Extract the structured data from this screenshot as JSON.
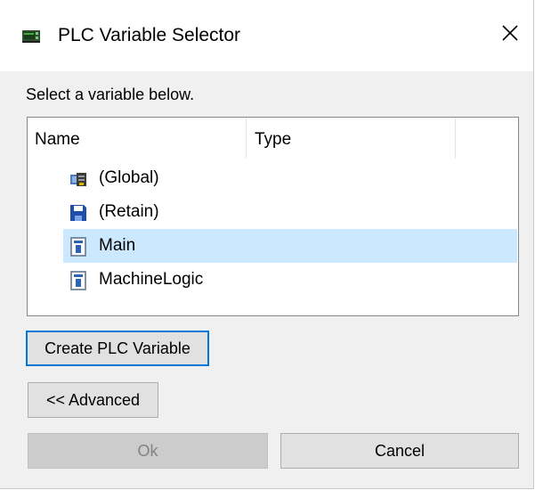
{
  "window": {
    "title": "PLC Variable Selector",
    "app_icon": "plc-device-icon",
    "close_icon": "close-icon"
  },
  "prompt": "Select a variable below.",
  "list": {
    "columns": [
      "Name",
      "Type"
    ],
    "rows": [
      {
        "label": "(Global)",
        "icon": "global-module-icon",
        "selected": false
      },
      {
        "label": "(Retain)",
        "icon": "save-disk-icon",
        "selected": false
      },
      {
        "label": "Main",
        "icon": "program-document-icon",
        "selected": true
      },
      {
        "label": "MachineLogic",
        "icon": "program-document-icon",
        "selected": false
      }
    ]
  },
  "buttons": {
    "create": "Create PLC Variable",
    "advanced": "<< Advanced",
    "ok": "Ok",
    "cancel": "Cancel"
  },
  "colors": {
    "selection": "#cce8ff",
    "focus_border": "#0078d7",
    "window_bg": "#f0f0f0"
  }
}
